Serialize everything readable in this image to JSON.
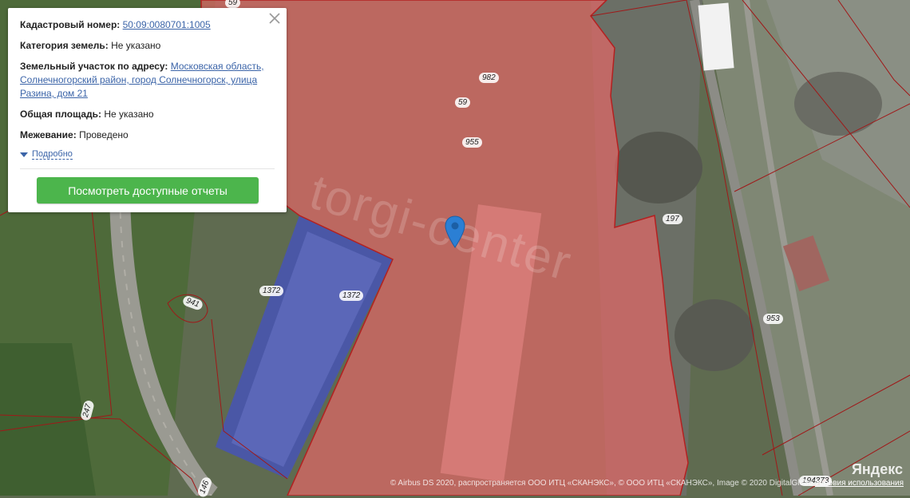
{
  "popup": {
    "cadastral_label": "Кадастровый номер:",
    "cadastral_value": "50:09:0080701:1005",
    "category_label": "Категория земель:",
    "category_value": "Не указано",
    "address_label": "Земельный участок по адресу:",
    "address_value": "Московская область, Солнечногорский район, город Солнечногорск, улица Разина, дом 21",
    "area_label": "Общая площадь:",
    "area_value": "Не указано",
    "survey_label": "Межевание:",
    "survey_value": "Проведено",
    "more_label": "Подробно",
    "reports_button": "Посмотреть доступные отчеты"
  },
  "map": {
    "parcel_labels": [
      "59",
      "982",
      "59",
      "955",
      "197",
      "1372",
      "1372",
      "941",
      "247",
      "953",
      "146",
      "194373"
    ],
    "watermark": "torgi-center",
    "yandex_logo": "Яндекс",
    "copyright": "© Airbus DS 2020, распространяется ООО ИТЦ «СКАНЭКС», © ООО ИТЦ «СКАНЭКС», Image © 2020 DigitalGlobe",
    "terms_link": "Условия использования",
    "highlight_color": "#e06666",
    "pin_color": "#2b7fd4"
  }
}
